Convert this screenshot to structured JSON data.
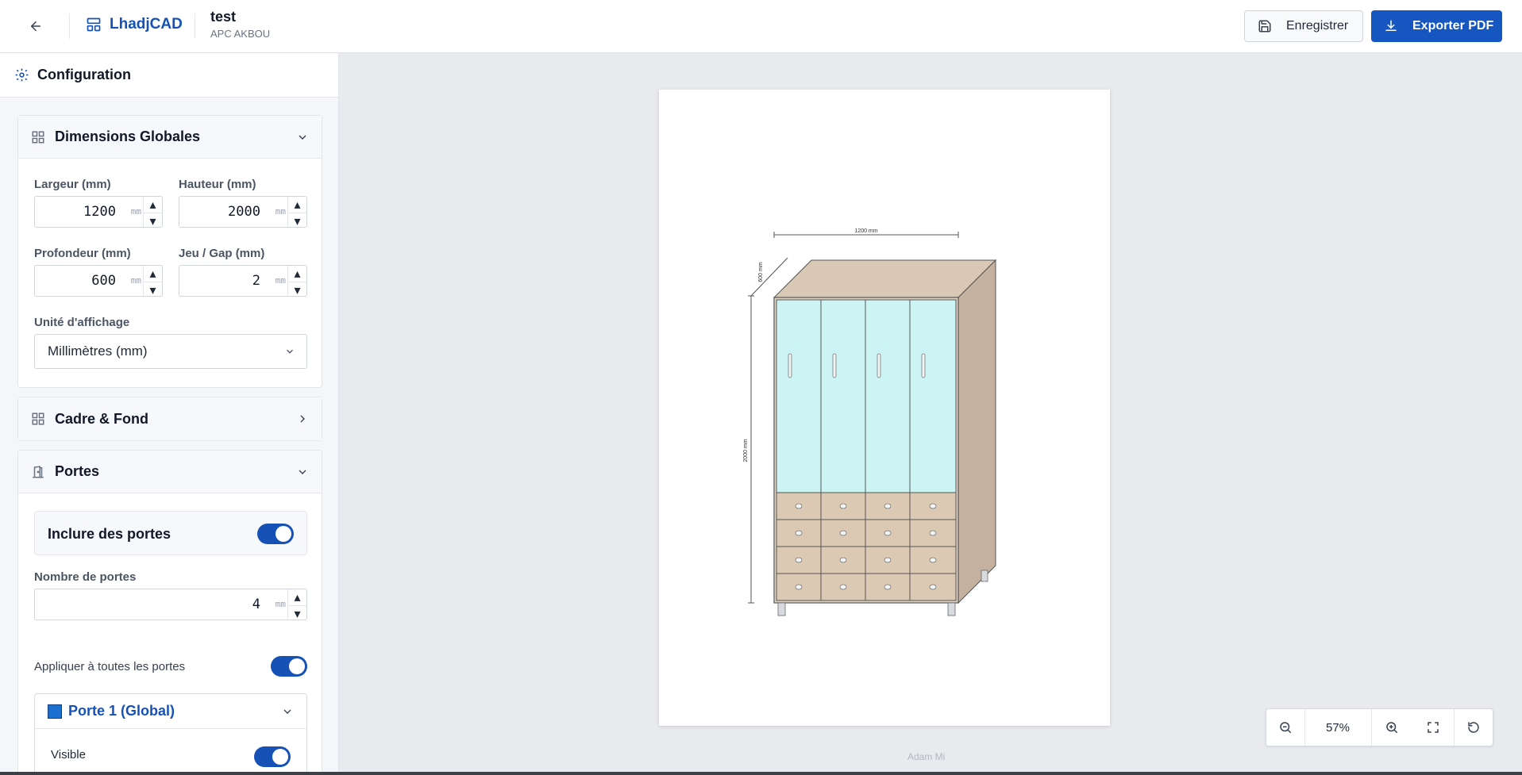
{
  "header": {
    "app_name": "LhadjCAD",
    "project_title": "test",
    "project_subtitle": "APC AKBOU",
    "save_label": "Enregistrer",
    "export_label": "Exporter PDF"
  },
  "sidebar": {
    "title": "Configuration",
    "dimensions": {
      "title": "Dimensions Globales",
      "width_label": "Largeur (mm)",
      "width_value": "1200",
      "height_label": "Hauteur (mm)",
      "height_value": "2000",
      "depth_label": "Profondeur (mm)",
      "depth_value": "600",
      "gap_label": "Jeu / Gap (mm)",
      "gap_value": "2",
      "unit_suffix": "mm",
      "display_unit_label": "Unité d'affichage",
      "display_unit_value": "Millimètres (mm)"
    },
    "frame": {
      "title": "Cadre & Fond"
    },
    "doors": {
      "title": "Portes",
      "include_label": "Inclure des portes",
      "include_on": true,
      "count_label": "Nombre de portes",
      "count_value": "4",
      "apply_all_label": "Appliquer à toutes les portes",
      "apply_all_on": true,
      "door_title": "Porte 1 (Global)",
      "door_color": "#1a6fd1",
      "visible_label": "Visible",
      "visible_on": true
    }
  },
  "drawing": {
    "width_dim": "1200 mm",
    "height_dim": "2000 mm",
    "depth_dim": "600 mm",
    "door_count": 4,
    "drawer_rows": 4
  },
  "zoom": {
    "value": "57%"
  },
  "footer": {
    "credit": "Adam Mi"
  },
  "colors": {
    "accent": "#1652b5",
    "glass": "#cdf4f4",
    "wood": "#dcc9b4"
  }
}
